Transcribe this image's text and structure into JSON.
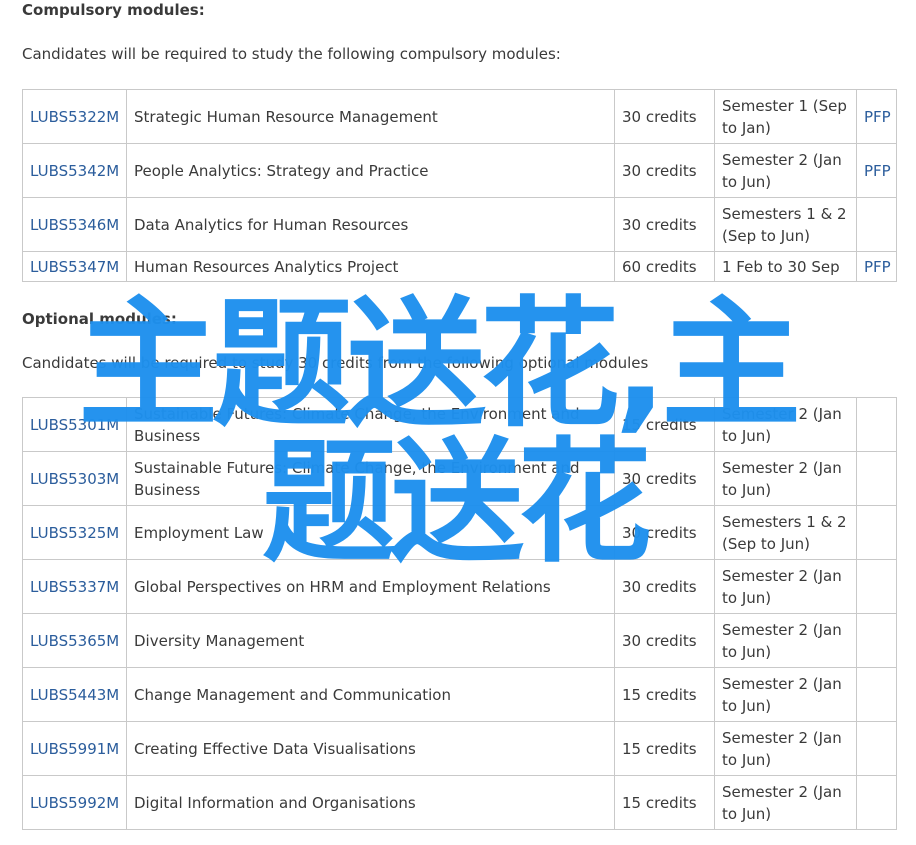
{
  "compulsory": {
    "heading": "Compulsory modules:",
    "intro": "Candidates will be required to study the following compulsory modules:",
    "rows": [
      {
        "code": "LUBS5322M",
        "title": "Strategic Human Resource Management",
        "credits": "30 credits",
        "semester": "Semester 1 (Sep to Jan)",
        "pfp": "PFP"
      },
      {
        "code": "LUBS5342M",
        "title": "People Analytics: Strategy and Practice",
        "credits": "30 credits",
        "semester": "Semester 2 (Jan to Jun)",
        "pfp": "PFP"
      },
      {
        "code": "LUBS5346M",
        "title": "Data Analytics for Human Resources",
        "credits": "30 credits",
        "semester": "Semesters 1 & 2 (Sep to Jun)",
        "pfp": ""
      },
      {
        "code": "LUBS5347M",
        "title": "Human Resources Analytics Project",
        "credits": "60 credits",
        "semester": "1 Feb to 30 Sep",
        "pfp": "PFP"
      }
    ]
  },
  "optional": {
    "heading": "Optional modules:",
    "intro": "Candidates will be required to study 30 credits from the following optional modules",
    "rows": [
      {
        "code": "LUBS5301M",
        "title": "Sustainable Futures: Climate Change, the Environment and Business",
        "credits": "15 credits",
        "semester": "Semester 2 (Jan to Jun)",
        "pfp": ""
      },
      {
        "code": "LUBS5303M",
        "title": "Sustainable Futures: Climate Change, the Environment and Business",
        "credits": "30 credits",
        "semester": "Semester 2 (Jan to Jun)",
        "pfp": ""
      },
      {
        "code": "LUBS5325M",
        "title": "Employment Law",
        "credits": "30 credits",
        "semester": "Semesters 1 & 2 (Sep to Jun)",
        "pfp": ""
      },
      {
        "code": "LUBS5337M",
        "title": "Global Perspectives on HRM and Employment Relations",
        "credits": "30 credits",
        "semester": "Semester 2 (Jan to Jun)",
        "pfp": ""
      },
      {
        "code": "LUBS5365M",
        "title": "Diversity Management",
        "credits": "30 credits",
        "semester": "Semester 2 (Jan to Jun)",
        "pfp": ""
      },
      {
        "code": "LUBS5443M",
        "title": "Change Management and Communication",
        "credits": "15 credits",
        "semester": "Semester 2 (Jan to Jun)",
        "pfp": ""
      },
      {
        "code": "LUBS5991M",
        "title": "Creating Effective Data Visualisations",
        "credits": "15 credits",
        "semester": "Semester 2 (Jan to Jun)",
        "pfp": ""
      },
      {
        "code": "LUBS5992M",
        "title": "Digital Information and Organisations",
        "credits": "15 credits",
        "semester": "Semester 2 (Jan to Jun)",
        "pfp": ""
      }
    ]
  },
  "watermark": {
    "line1": "主题送花,主",
    "line2": "题送花",
    "color": "#1e90ee"
  },
  "colors": {
    "link": "#2b5d9c",
    "text": "#3a3a3a",
    "border": "#c9c9c9"
  }
}
